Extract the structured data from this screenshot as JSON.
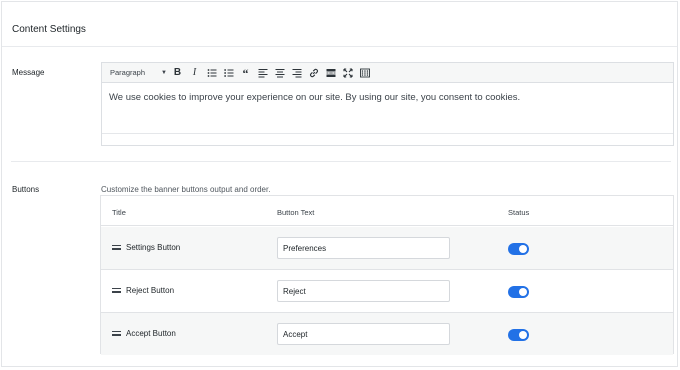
{
  "section_title": "Content Settings",
  "message": {
    "label": "Message",
    "toolbar": {
      "format_value": "Paragraph",
      "buttons": [
        "bold-icon",
        "italic-icon",
        "bullet-list-icon",
        "numbered-list-icon",
        "blockquote-icon",
        "align-left-icon",
        "align-center-icon",
        "align-right-icon",
        "link-icon",
        "read-more-icon",
        "fullscreen-icon",
        "toolbar-toggle-icon"
      ]
    },
    "content": "We use cookies to improve your experience on our site. By using our site, you consent to cookies."
  },
  "buttons": {
    "label": "Buttons",
    "description": "Customize the banner buttons output and order.",
    "columns": {
      "title": "Title",
      "text": "Button Text",
      "status": "Status"
    },
    "rows": [
      {
        "title": "Settings Button",
        "text": "Preferences",
        "enabled": true
      },
      {
        "title": "Reject Button",
        "text": "Reject",
        "enabled": true
      },
      {
        "title": "Accept Button",
        "text": "Accept",
        "enabled": true
      }
    ]
  },
  "colors": {
    "toggle_on": "#2271e6",
    "border": "#e1e3e6",
    "row_alt": "#f6f7f7"
  }
}
